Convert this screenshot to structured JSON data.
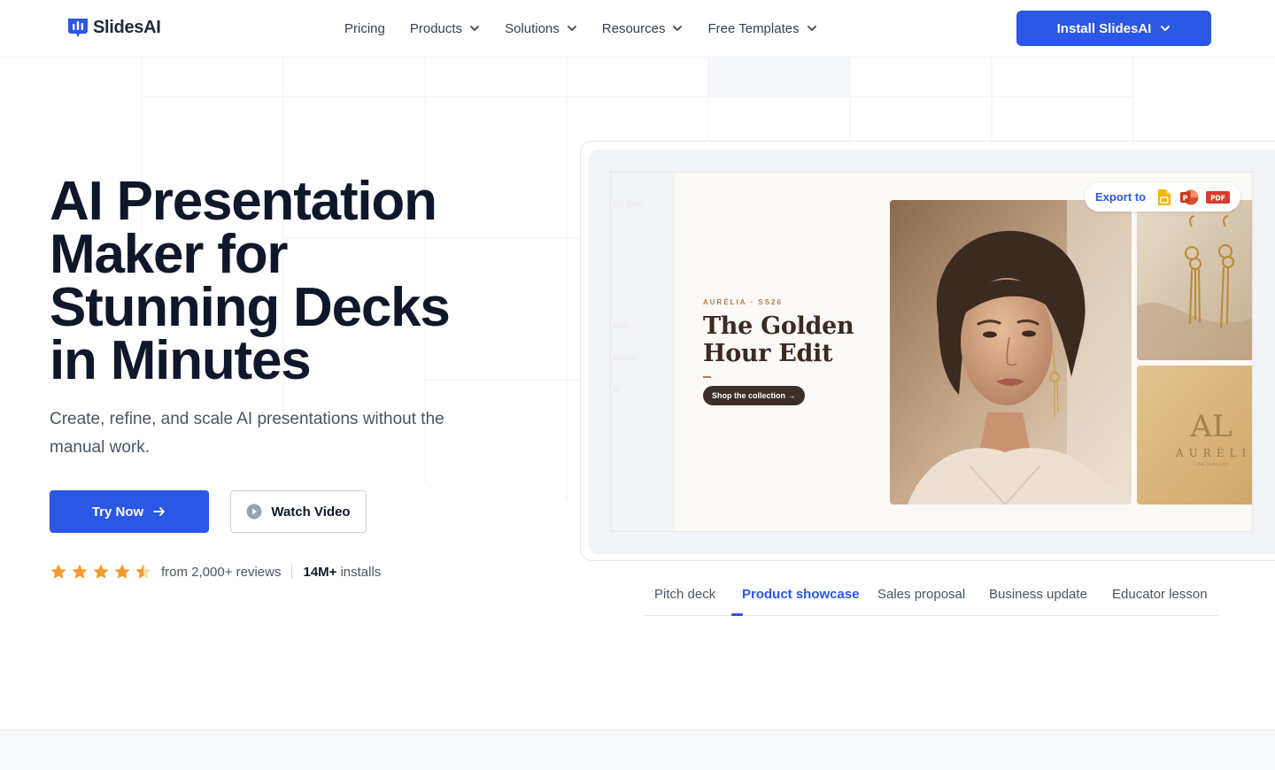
{
  "header": {
    "brand": "SlidesAI",
    "nav": [
      {
        "label": "Pricing",
        "has_dropdown": false
      },
      {
        "label": "Products",
        "has_dropdown": true
      },
      {
        "label": "Solutions",
        "has_dropdown": true
      },
      {
        "label": "Resources",
        "has_dropdown": true
      },
      {
        "label": "Free Templates",
        "has_dropdown": true
      }
    ],
    "install_label": "Install SlidesAI"
  },
  "hero": {
    "title_lines": [
      "AI Presentation",
      "Maker for",
      "Stunning Decks",
      "in Minutes"
    ],
    "subtitle": "Create, refine, and scale AI presentations without the manual work.",
    "try_label": "Try Now",
    "watch_label": "Watch Video",
    "rating_stars": 4.5,
    "reviews_text": "from 2,000+ reviews",
    "installs_num": "14M+",
    "installs_label": "installs"
  },
  "preview": {
    "export_label": "Export to",
    "export_formats": [
      "Google Slides",
      "PowerPoint",
      "PDF"
    ],
    "pdf_badge": "PDF",
    "ppt_badge": "P",
    "slide": {
      "brand_line": "AURÉLIA · SS26",
      "title": "The Golden Hour Edit",
      "cta": "Shop the collection →",
      "logo_monogram": "AL",
      "logo_word": "AURÉLIA",
      "logo_tag": "FINE JEWELRY"
    }
  },
  "tabs": {
    "items": [
      "Pitch deck",
      "Product showcase",
      "Sales proposal",
      "Business update",
      "Educator lesson"
    ],
    "active": "Product showcase"
  },
  "colors": {
    "accent": "#2b57e5",
    "heading": "#0f172a",
    "star": "#f29b2c",
    "slide_brown": "#3b2a22"
  }
}
